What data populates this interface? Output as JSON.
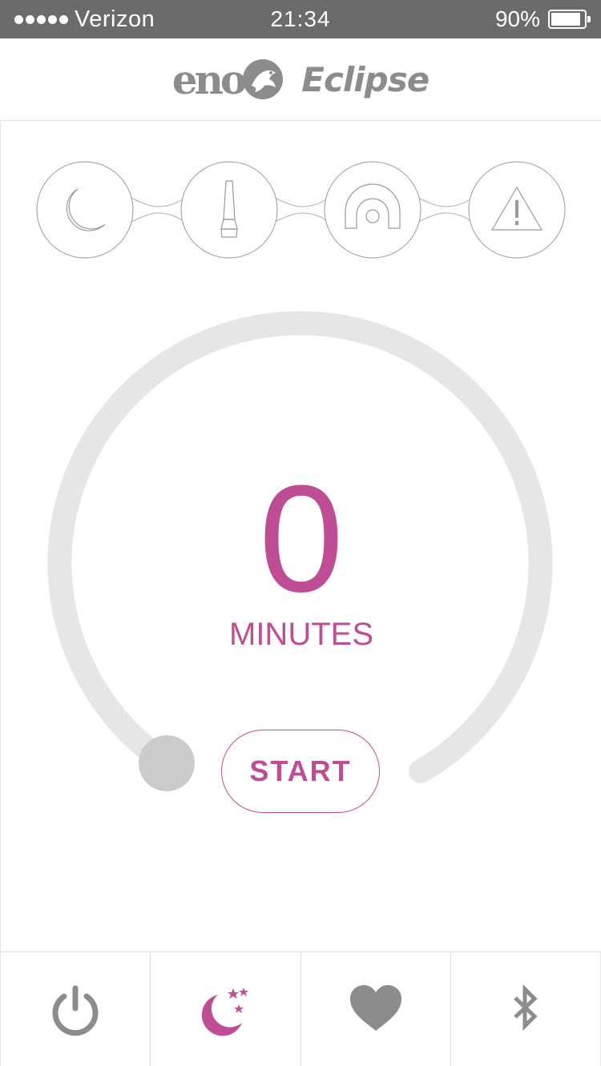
{
  "status_bar": {
    "carrier": "Verizon",
    "time": "21:34",
    "battery_percent": "90%"
  },
  "header": {
    "brand": "eno",
    "product": "Eclipse"
  },
  "modes": [
    {
      "name": "sleep",
      "icon": "moon-icon"
    },
    {
      "name": "lava-lamp",
      "icon": "lava-lamp-icon"
    },
    {
      "name": "rainbow",
      "icon": "rainbow-icon"
    },
    {
      "name": "alert",
      "icon": "warning-icon"
    }
  ],
  "timer": {
    "value": "0",
    "unit": "MINUTES",
    "start_label": "START",
    "level": 0
  },
  "tabs": [
    {
      "name": "power",
      "icon": "power-icon",
      "active": false
    },
    {
      "name": "sleep",
      "icon": "moon-stars-icon",
      "active": true
    },
    {
      "name": "favorites",
      "icon": "heart-icon",
      "active": false
    },
    {
      "name": "bluetooth",
      "icon": "bluetooth-icon",
      "active": false
    }
  ],
  "colors": {
    "accent": "#bf4d96",
    "status_bar": "#6b6b6b",
    "track": "#e6e6e6",
    "icon_gray": "#8c8c8c"
  }
}
